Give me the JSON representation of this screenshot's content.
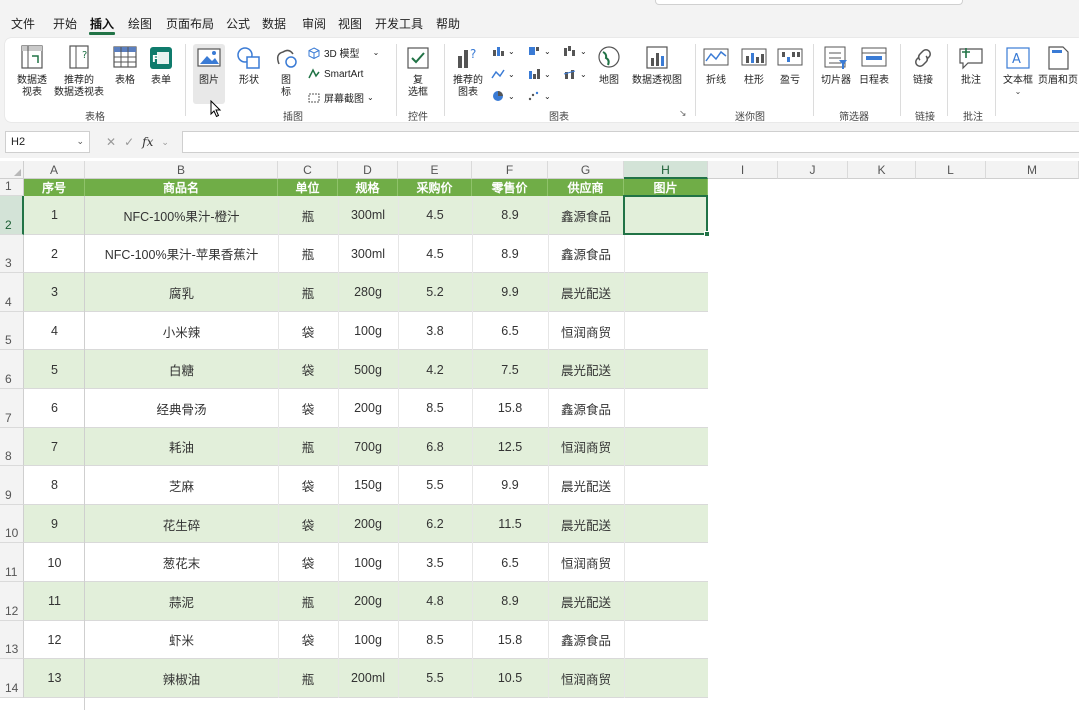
{
  "menu": {
    "tabs": [
      "文件",
      "开始",
      "插入",
      "绘图",
      "页面布局",
      "公式",
      "数据",
      "审阅",
      "视图",
      "开发工具",
      "帮助"
    ],
    "active_tab": "插入"
  },
  "ribbon": {
    "groups": {
      "tables": {
        "label": "表格",
        "pivot_table": "数据透\n视表",
        "recommended_pivot": "推荐的\n数据透视表",
        "table": "表格",
        "form": "表单"
      },
      "illustrations": {
        "label": "插图",
        "pictures": "图片",
        "shapes": "形状",
        "icons": "图\n标",
        "models_3d": "3D 模型",
        "smartart": "SmartArt",
        "screenshot": "屏幕截图"
      },
      "controls": {
        "label": "控件",
        "checkbox": "复\n选框"
      },
      "charts": {
        "label": "图表",
        "recommended_charts": "推荐的\n图表",
        "maps": "地图",
        "pivot_chart": "数据透视图"
      },
      "sparklines": {
        "label": "迷你图",
        "line": "折线",
        "column": "柱形",
        "win_loss": "盈亏"
      },
      "filters": {
        "label": "筛选器",
        "slicer": "切片器",
        "timeline": "日程表"
      },
      "links": {
        "label": "链接",
        "link": "链接"
      },
      "comments": {
        "label": "批注",
        "comment": "批注"
      },
      "text": {
        "textbox": "文本框",
        "header_footer": "页眉和页"
      }
    }
  },
  "formula_bar": {
    "name_box": "H2",
    "fx_label": "fx",
    "formula": ""
  },
  "sheet": {
    "columns": [
      "A",
      "B",
      "C",
      "D",
      "E",
      "F",
      "G",
      "H",
      "I",
      "J",
      "K",
      "L",
      "M"
    ],
    "row_numbers": [
      "1",
      "2",
      "3",
      "4",
      "5",
      "6",
      "7",
      "8",
      "9",
      "10",
      "11",
      "12",
      "13",
      "14"
    ],
    "selected_cell": "H2",
    "headers": [
      "序号",
      "商品名",
      "单位",
      "规格",
      "采购价",
      "零售价",
      "供应商",
      "图片"
    ],
    "rows": [
      [
        "1",
        "NFC-100%果汁-橙汁",
        "瓶",
        "300ml",
        "4.5",
        "8.9",
        "鑫源食品",
        ""
      ],
      [
        "2",
        "NFC-100%果汁-苹果香蕉汁",
        "瓶",
        "300ml",
        "4.5",
        "8.9",
        "鑫源食品",
        ""
      ],
      [
        "3",
        "腐乳",
        "瓶",
        "280g",
        "5.2",
        "9.9",
        "晨光配送",
        ""
      ],
      [
        "4",
        "小米辣",
        "袋",
        "100g",
        "3.8",
        "6.5",
        "恒润商贸",
        ""
      ],
      [
        "5",
        "白糖",
        "袋",
        "500g",
        "4.2",
        "7.5",
        "晨光配送",
        ""
      ],
      [
        "6",
        "经典骨汤",
        "袋",
        "200g",
        "8.5",
        "15.8",
        "鑫源食品",
        ""
      ],
      [
        "7",
        "耗油",
        "瓶",
        "700g",
        "6.8",
        "12.5",
        "恒润商贸",
        ""
      ],
      [
        "8",
        "芝麻",
        "袋",
        "150g",
        "5.5",
        "9.9",
        "晨光配送",
        ""
      ],
      [
        "9",
        "花生碎",
        "袋",
        "200g",
        "6.2",
        "11.5",
        "晨光配送",
        ""
      ],
      [
        "10",
        "葱花末",
        "袋",
        "100g",
        "3.5",
        "6.5",
        "恒润商贸",
        ""
      ],
      [
        "11",
        "蒜泥",
        "瓶",
        "200g",
        "4.8",
        "8.9",
        "晨光配送",
        ""
      ],
      [
        "12",
        "虾米",
        "袋",
        "100g",
        "8.5",
        "15.8",
        "鑫源食品",
        ""
      ],
      [
        "13",
        "辣椒油",
        "瓶",
        "200ml",
        "5.5",
        "10.5",
        "恒润商贸",
        ""
      ]
    ]
  },
  "colors": {
    "header_green": "#70ad47",
    "band_green": "#e2efda",
    "excel_green": "#217346"
  }
}
